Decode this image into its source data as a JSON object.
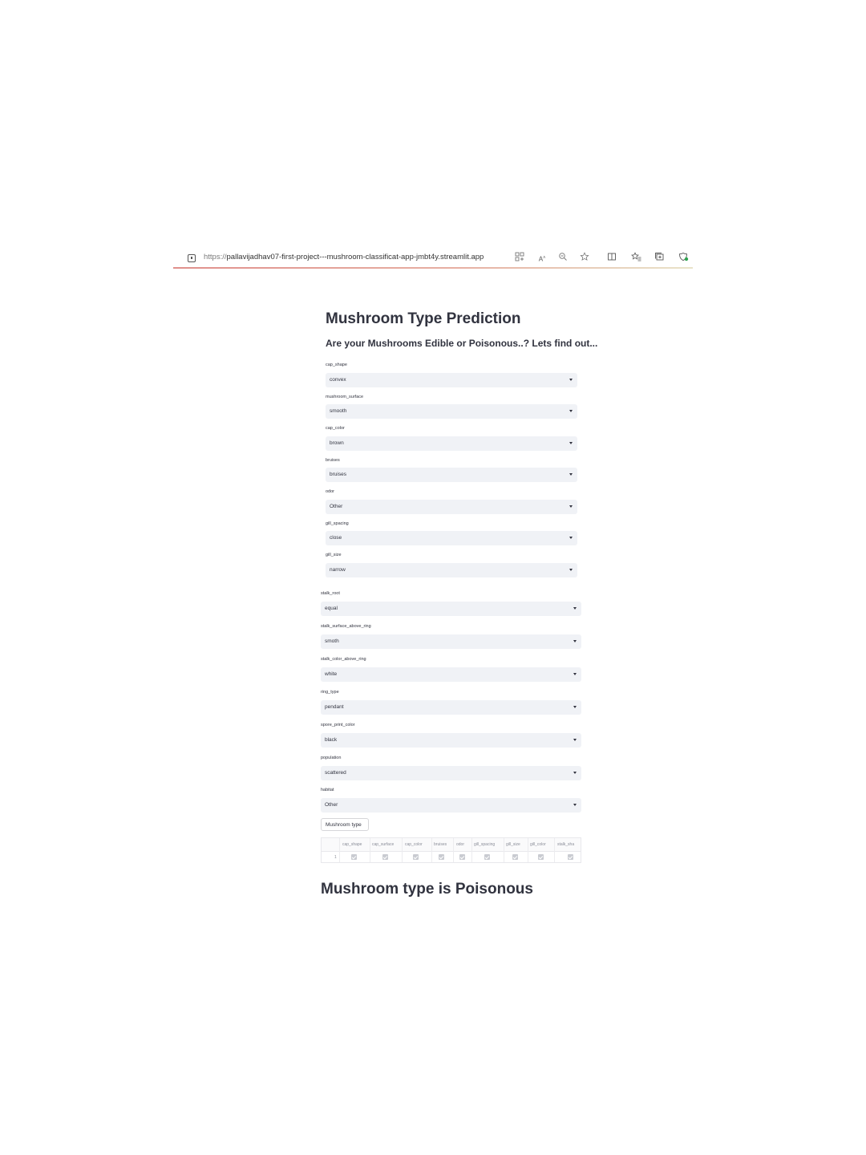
{
  "browser": {
    "url_protocol": "https://",
    "url_host": "pallavijadhav07-first-project---mushroom-classificat-app-jmbt4y.streamlit.app",
    "toolbar_icons": [
      "app-grid-icon",
      "read-aloud-icon",
      "zoom-icon",
      "favorite-star-icon",
      "split-screen-icon",
      "favorites-icon",
      "collections-icon",
      "browser-essentials-icon"
    ]
  },
  "page": {
    "title": "Mushroom Type Prediction",
    "subtitle": "Are your Mushrooms Edible or Poisonous..? Lets find out..."
  },
  "fields": [
    {
      "label": "cap_shape",
      "value": "convex"
    },
    {
      "label": "mushroom_surface",
      "value": "smooth"
    },
    {
      "label": "cap_color",
      "value": "brown"
    },
    {
      "label": "bruises",
      "value": "bruises"
    },
    {
      "label": "odor",
      "value": "Other"
    },
    {
      "label": "gill_spacing",
      "value": "close"
    },
    {
      "label": "gill_size",
      "value": "narrow"
    },
    {
      "label": "stalk_root",
      "value": "equal"
    },
    {
      "label": "stalk_surface_above_ring",
      "value": "smoth"
    },
    {
      "label": "stalk_color_above_ring",
      "value": "white"
    },
    {
      "label": "ring_type",
      "value": "pendant"
    },
    {
      "label": "spore_print_color",
      "value": "black"
    },
    {
      "label": "population",
      "value": "scattered"
    },
    {
      "label": "habitat",
      "value": "Other"
    }
  ],
  "button": {
    "label": "Mushroom type"
  },
  "dataframe": {
    "columns": [
      "cap_shape",
      "cap_surface",
      "cap_color",
      "bruises",
      "odor",
      "gill_spacing",
      "gill_size",
      "gill_color",
      "stalk_sha"
    ],
    "row_index": "1"
  },
  "result": {
    "text": "Mushroom type is Poisonous"
  }
}
